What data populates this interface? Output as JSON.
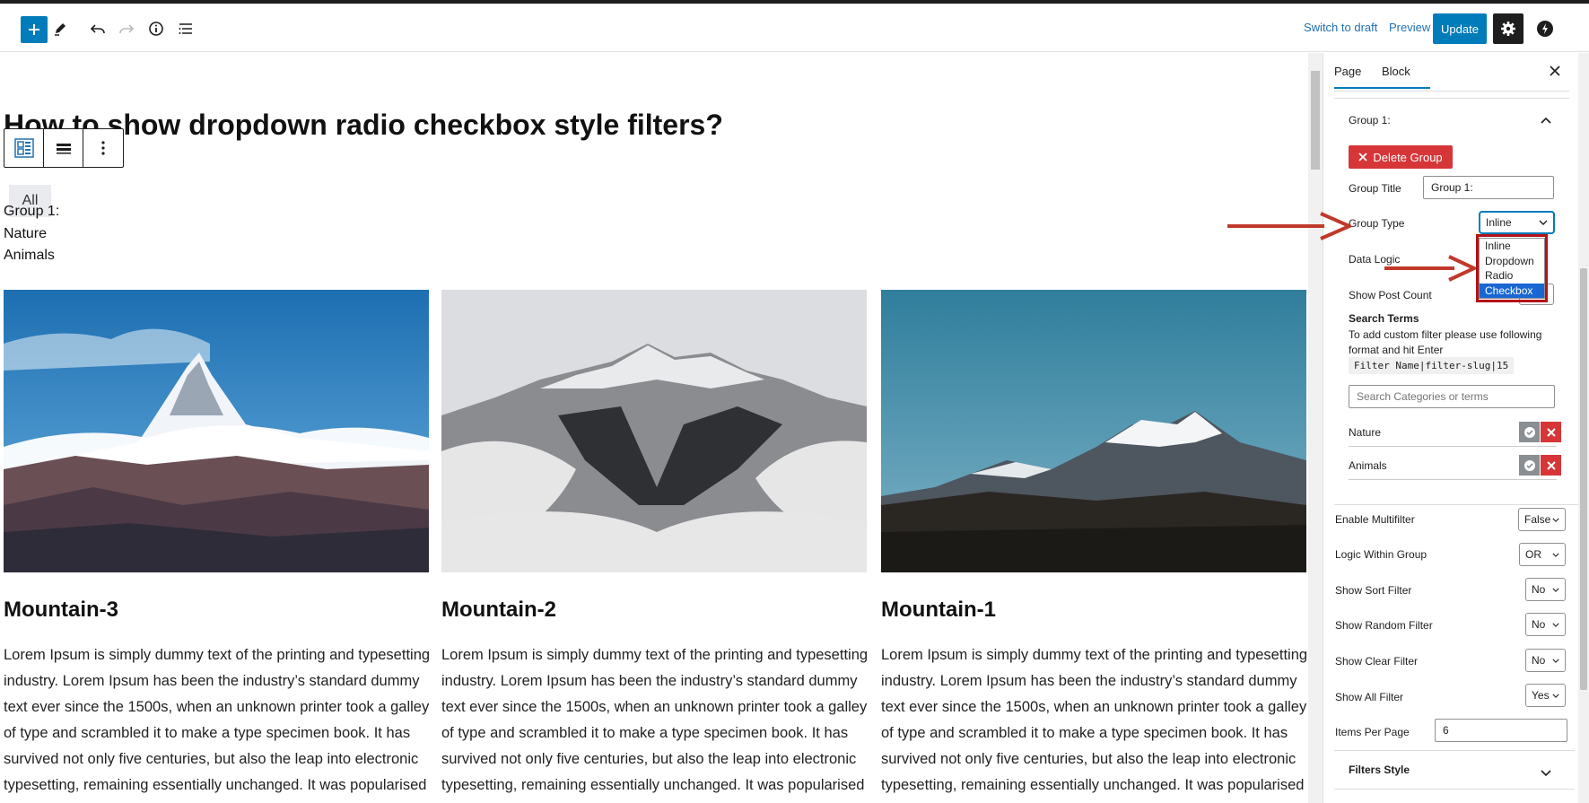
{
  "toolbar": {
    "switch_to_draft": "Switch to draft",
    "preview": "Preview",
    "update": "Update"
  },
  "page": {
    "title": "How to show dropdown radio checkbox style filters?",
    "all_button": "All",
    "group_label": "Group 1:",
    "filters": [
      "Nature",
      "Animals"
    ]
  },
  "posts": [
    {
      "title": "Mountain-3",
      "text": "Lorem Ipsum is simply dummy text of the printing and typesetting industry. Lorem Ipsum has been the industry’s standard dummy text ever since the 1500s, when an unknown printer took a galley of type and scrambled it to make a type specimen book. It has survived not only five centuries, but also the leap into electronic typesetting, remaining essentially unchanged. It was popularised"
    },
    {
      "title": "Mountain-2",
      "text": "Lorem Ipsum is simply dummy text of the printing and typesetting industry. Lorem Ipsum has been the industry’s standard dummy text ever since the 1500s, when an unknown printer took a galley of type and scrambled it to make a type specimen book. It has survived not only five centuries, but also the leap into electronic typesetting, remaining essentially unchanged. It was popularised"
    },
    {
      "title": "Mountain-1",
      "text": "Lorem Ipsum is simply dummy text of the printing and typesetting industry. Lorem Ipsum has been the industry’s standard dummy text ever since the 1500s, when an unknown printer took a galley of type and scrambled it to make a type specimen book. It has survived not only five centuries, but also the leap into electronic typesetting, remaining essentially unchanged. It was popularised"
    }
  ],
  "sidebar": {
    "tabs": [
      "Page",
      "Block"
    ],
    "group_header": "Group 1:",
    "delete_group": "Delete Group",
    "group_title_label": "Group Title",
    "group_title_value": "Group 1:",
    "group_type_label": "Group Type",
    "group_type_value": "Inline",
    "group_type_options": [
      "Inline",
      "Dropdown",
      "Radio",
      "Checkbox"
    ],
    "data_logic_label": "Data Logic",
    "show_post_count_label": "Show Post Count",
    "search_terms_heading": "Search Terms",
    "search_terms_help": "To add custom filter please use following format and hit Enter",
    "search_terms_format": "Filter Name|filter-slug|15",
    "search_placeholder": "Search Categories or terms",
    "terms": [
      "Nature",
      "Animals"
    ],
    "settings": [
      {
        "label": "Enable Multifilter",
        "value": "False"
      },
      {
        "label": "Logic Within Group",
        "value": "OR"
      },
      {
        "label": "Show Sort Filter",
        "value": "No"
      },
      {
        "label": "Show Random Filter",
        "value": "No"
      },
      {
        "label": "Show Clear Filter",
        "value": "No"
      },
      {
        "label": "Show All Filter",
        "value": "Yes"
      }
    ],
    "items_per_page_label": "Items Per Page",
    "items_per_page_value": "6",
    "filters_style": "Filters Style"
  },
  "colors": {
    "accent": "#007cba",
    "danger": "#d63638",
    "annotation_arrow": "#c0392b"
  }
}
